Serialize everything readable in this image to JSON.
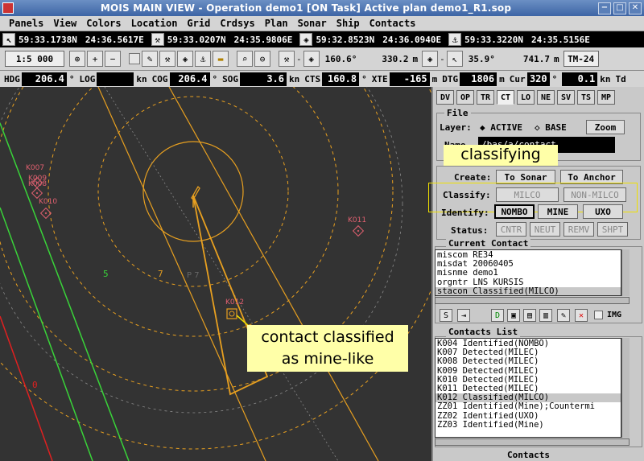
{
  "window": {
    "title": "MOIS MAIN VIEW - Operation demo1 [ON Task]   Active plan demo1_R1.sop",
    "buttons": [
      "−",
      "□",
      "✕"
    ]
  },
  "menu": [
    "Panels",
    "View",
    "Colors",
    "Location",
    "Grid",
    "Crdsys",
    "Plan",
    "Sonar",
    "Ship",
    "Contacts"
  ],
  "positions": [
    {
      "icon": "cursor-arrow-icon",
      "glyph": "↖",
      "lat": "59:33.1738N",
      "lon": "24:36.5617E"
    },
    {
      "icon": "ship-icon",
      "glyph": "⚒",
      "lat": "59:33.0207N",
      "lon": "24:35.9806E"
    },
    {
      "icon": "diamond-target-icon",
      "glyph": "◈",
      "lat": "59:32.8523N",
      "lon": "24:36.0940E"
    },
    {
      "icon": "anchor-icon",
      "glyph": "⚓",
      "lat": "59:33.3220N",
      "lon": "24:35.5156E"
    }
  ],
  "toolbar": {
    "scale": "1:5 000",
    "bearing1": "160.6°",
    "range1": "330.2",
    "range1_unit": "m",
    "bearing2": "35.9°",
    "range2": "741.7",
    "range2_unit": "m",
    "tm": "TM-24"
  },
  "nav": {
    "hdg_label": "HDG",
    "hdg": "206.4",
    "log_label": "LOG",
    "log": "",
    "log_unit": "kn",
    "cog_label": "COG",
    "cog": "206.4",
    "sog_label": "SOG",
    "sog": "3.6",
    "sog_unit": "kn",
    "cts_label": "CTS",
    "cts": "160.8",
    "xte_label": "XTE",
    "xte": "-165",
    "xte_unit": "m",
    "dtg_label": "DTG",
    "dtg": "1806",
    "dtg_unit": "m",
    "cur_label": "Cur",
    "cur_dir": "320",
    "cur_speed": "0.1",
    "cur_unit": "kn",
    "td_label": "Td",
    "degree": "°"
  },
  "map": {
    "contacts": [
      {
        "id": "K007",
        "label": "K007"
      },
      {
        "id": "K009",
        "label": "K009"
      },
      {
        "id": "K008",
        "label": "K008"
      },
      {
        "id": "K010",
        "label": "K010"
      },
      {
        "id": "K011",
        "label": "K011"
      },
      {
        "id": "K012",
        "label": "K012"
      }
    ],
    "grid_numbers": [
      "5",
      "7",
      "0"
    ],
    "dim_label": "P 7"
  },
  "panel": {
    "tabs": [
      "DV",
      "OP",
      "TR",
      "CT",
      "LO",
      "NE",
      "SV",
      "TS",
      "MP"
    ],
    "active_tab": "CT",
    "file_section": "File",
    "layer_label": "Layer:",
    "layer_active": "ACTIVE",
    "layer_base": "BASE",
    "zoom_button": "Zoom",
    "name_label": "Name",
    "name_value": "/bas/a/contact",
    "create_label": "Create:",
    "to_sonar": "To Sonar",
    "to_anchor": "To Anchor",
    "classify_label": "Classify:",
    "milco": "MILCO",
    "non_milco": "NON-MILCO",
    "identify_label": "Identify:",
    "nombo": "NOMBO",
    "mine": "MINE",
    "uxo": "UXO",
    "status_label": "Status:",
    "status_buttons": [
      "CNTR",
      "NEUT",
      "REMV",
      "SHPT"
    ],
    "current_contact_title": "Current Contact",
    "current_contact": [
      "miscom RE34",
      "misdat 20060405",
      "misnme demo1",
      "orgntr LNS KURSIS",
      "stacon Classified(MILCO)"
    ],
    "img_label": "IMG",
    "contacts_list_title": "Contacts List",
    "contacts_list": [
      "K004  Identified(NOMBO)",
      "K007  Detected(MILEC)",
      "K008  Detected(MILEC)",
      "K009  Detected(MILEC)",
      "K010  Detected(MILEC)",
      "K011  Detected(MILEC)",
      "K012  Classified(MILCO)",
      "ZZ01  Identified(Mine);Countermi",
      "ZZ02  Identified(UXO)",
      "ZZ03  Identified(Mine)"
    ],
    "selected_contact_index": 6,
    "footer": "Contacts"
  },
  "annotations": {
    "classifying": "classifying",
    "contact_classified_1": "contact classified",
    "contact_classified_2": "as mine-like"
  },
  "colors": {
    "map_bg": "#333333",
    "range_ring": "#e8a020",
    "contact": "#e06070",
    "grid_green": "#39d439",
    "red_line": "#e02020",
    "annotation_bg": "#ffffa8"
  }
}
